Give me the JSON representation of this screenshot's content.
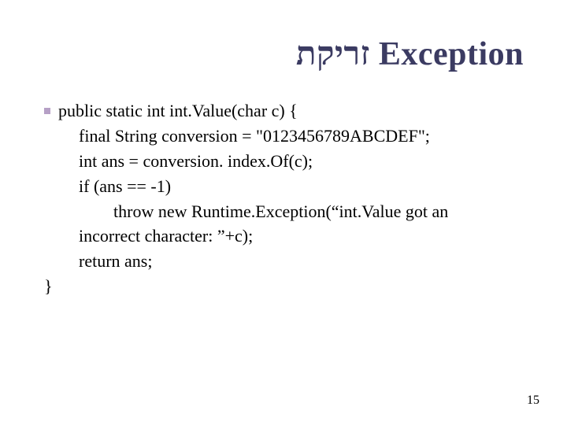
{
  "title": "זריקת Exception",
  "code": {
    "signature": "public static int int.Value(char c) {",
    "l1": "final String conversion = \"0123456789ABCDEF\";",
    "l2": "int ans = conversion. index.Of(c);",
    "l3": "if (ans == -1)",
    "l4": "throw new Runtime.Exception(“int.Value got an",
    "l5": "incorrect character: ”+c);",
    "l6": "return  ans;",
    "close": "}"
  },
  "page": "15"
}
